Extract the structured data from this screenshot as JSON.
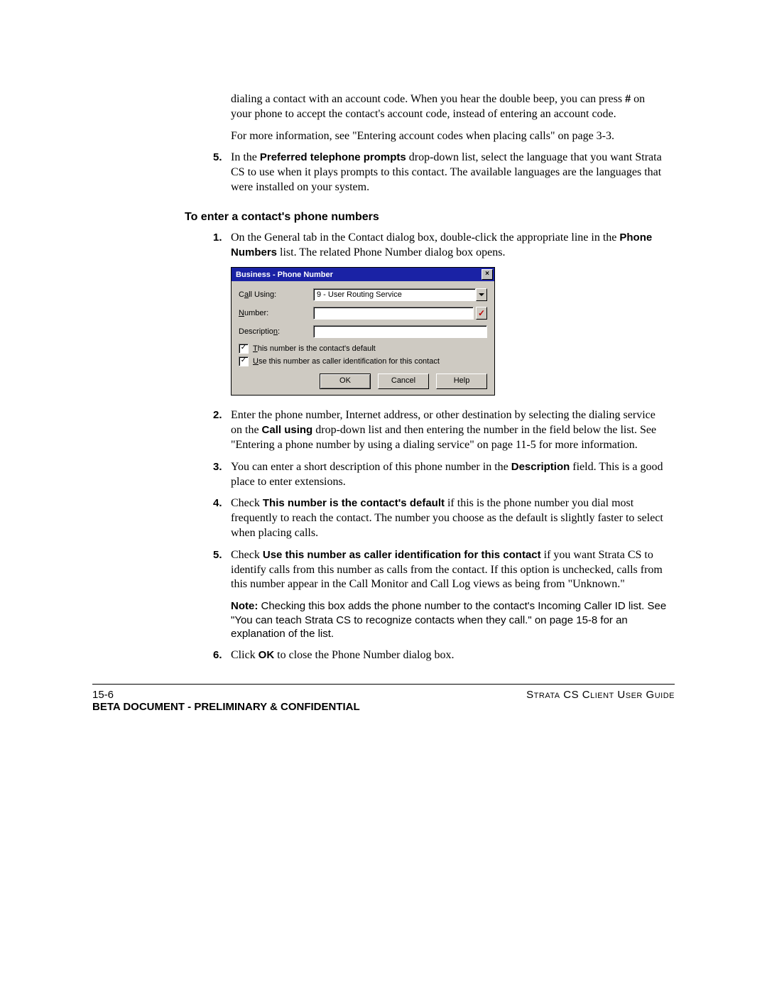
{
  "text": {
    "p1a": "dialing a contact with an account code. When you hear the double beep, you can press ",
    "p1b": "#",
    "p1c": " on your phone to accept the contact's account code, instead of entering an account code.",
    "p2": "For more information, see \"Entering account codes when placing calls\" on page 3-3.",
    "s5num": "5.",
    "s5a": "In the ",
    "s5b": "Preferred telephone prompts",
    "s5c": " drop-down list, select the language that you want Strata CS to use when it plays prompts to this contact. The available languages are the languages that were installed on your system.",
    "subhead": "To enter a contact's phone numbers",
    "b1num": "1.",
    "b1a": "On the General tab in the Contact dialog box, double-click the appropriate line in the ",
    "b1b": "Phone Numbers",
    "b1c": " list. The related Phone Number dialog box opens.",
    "b2num": "2.",
    "b2a": "Enter the phone number, Internet address, or other destination by selecting the dialing service on the ",
    "b2b": "Call using",
    "b2c": " drop-down list and then entering the number in the field below the list. See \"Entering a phone number by using a dialing service\" on page 11-5 for more information.",
    "b3num": "3.",
    "b3a": "You can enter a short description of this phone number in the ",
    "b3b": "Description",
    "b3c": " field. This is a good place to enter extensions.",
    "b4num": "4.",
    "b4a": "Check ",
    "b4b": "This number is the contact's default",
    "b4c": " if this is the phone number you dial most frequently to reach the contact. The number you choose as the default is slightly faster to select when placing calls.",
    "b5num": "5.",
    "b5a": "Check ",
    "b5b": "Use this number as caller identification for this contact",
    "b5c": " if you want Strata CS to identify calls from this number as calls from the contact. If this option is unchecked, calls from this number appear in the Call Monitor and Call Log views as being from \"Unknown.\"",
    "notelabel": "Note:  ",
    "notebody": "Checking this box adds the phone number to the contact's Incoming Caller ID list. See \"You can teach Strata CS to recognize contacts when they call.\" on page 15-8 for an explanation of the list.",
    "b6num": "6.",
    "b6a": "Click ",
    "b6b": "OK",
    "b6c": " to close the Phone Number dialog box."
  },
  "dialog": {
    "title": "Business - Phone Number",
    "close": "×",
    "label_callusing_pre": "C",
    "label_callusing_u": "a",
    "label_callusing_post": "ll Using:",
    "callusing_value": "9 - User Routing Service",
    "label_number_u": "N",
    "label_number_post": "umber:",
    "label_desc_pre": "Descriptio",
    "label_desc_u": "n",
    "label_desc_post": ":",
    "chk1_u": "T",
    "chk1_post": "his number is the contact's default",
    "chk2_u": "U",
    "chk2_post": "se this number as caller identification for this contact",
    "ok": "OK",
    "cancel": "Cancel",
    "help": "Help",
    "checkmark": "✓"
  },
  "footer": {
    "pagenum": "15-6",
    "guide": "Strata CS Client User Guide",
    "confidential": "BETA DOCUMENT - PRELIMINARY & CONFIDENTIAL"
  }
}
